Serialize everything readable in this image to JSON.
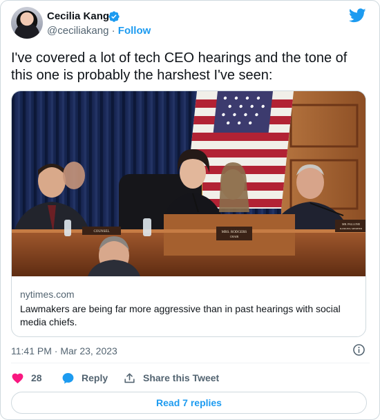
{
  "author": {
    "name": "Cecilia Kang",
    "handle": "@ceciliakang",
    "separator": " · ",
    "follow_label": "Follow"
  },
  "tweet": {
    "text": "I've covered a lot of tech CEO hearings and the tone of this one is probably the harshest I've seen:",
    "timestamp": "11:41 PM · Mar 23, 2023"
  },
  "card": {
    "domain": "nytimes.com",
    "title": "Lawmakers are being far more aggressive than in past hearings with social media chiefs.",
    "nameplates": {
      "center_name": "MRS. RODGERS",
      "center_role": "CHAIR",
      "left": "COUNSEL",
      "right_name": "MR. PALLONE",
      "right_role": "RANKING MEMBER"
    }
  },
  "actions": {
    "like_count": "28",
    "reply_label": "Reply",
    "share_label": "Share this Tweet",
    "read_replies_label": "Read 7 replies"
  },
  "colors": {
    "accent": "#1d9bf0",
    "like": "#f91880",
    "muted": "#536471"
  },
  "icons": [
    "verified-badge-icon",
    "twitter-bird-icon",
    "info-icon",
    "heart-icon",
    "reply-bubble-icon",
    "share-icon"
  ]
}
